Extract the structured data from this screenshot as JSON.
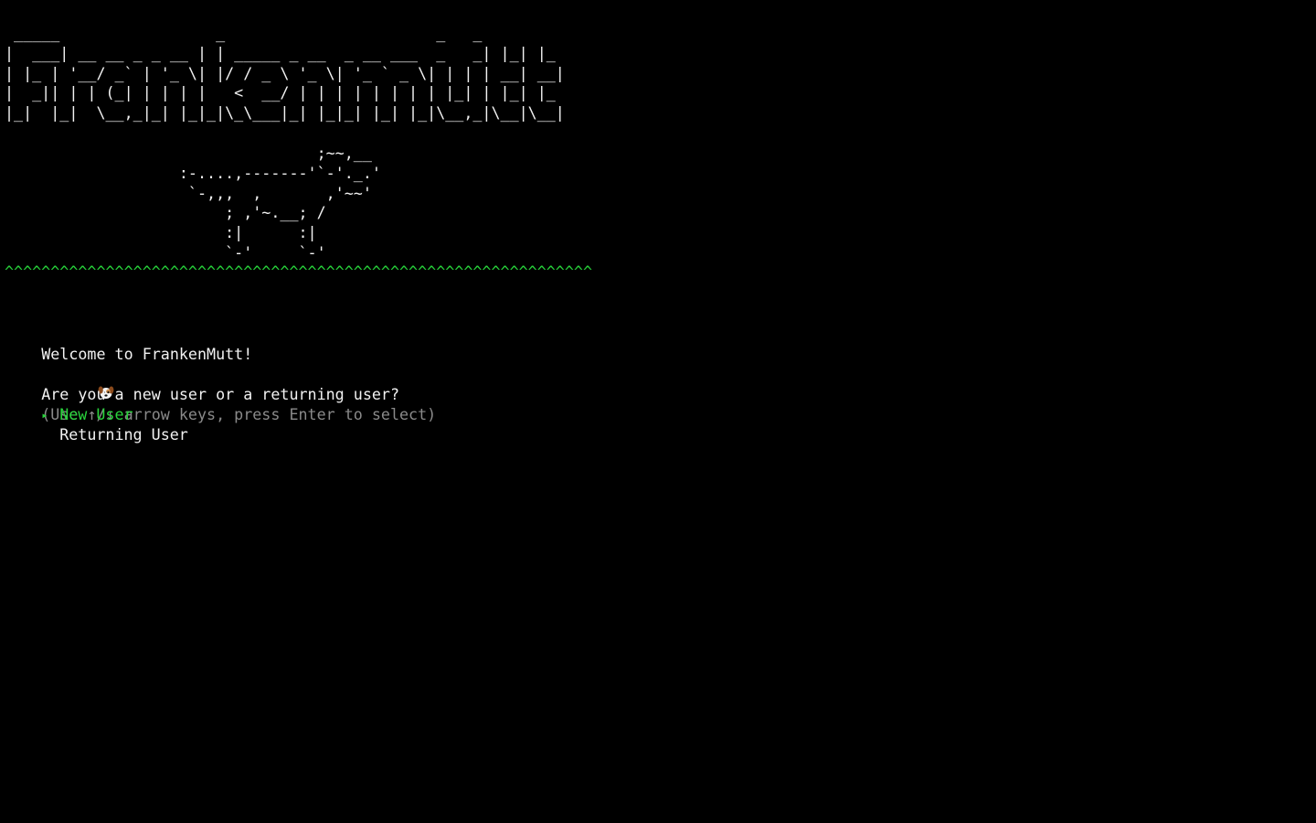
{
  "banner": {
    "ascii_art": " _____                 _                       _   _\n|  ___| __ __ _ _ __ | | _____ _ __  _ __ ___  _   _| |_| |_\n| |_ | '__/ _` | '_ \\| |/ / _ \\ '_ \\| '_ ` _ \\| | | | __| __|\n|  _|| | | (_| | | | |   <  __/ | | | | | | | | |_| | |_| |_\n|_|  |_|  \\__,_|_| |_|_|\\_\\___|_| |_|_| |_| |_|\\__,_|\\__|\\__|"
  },
  "dog_art": "                                  ;~~,__\n                   :-....,-------'`-'._.'\n                    `-,,,  ,       ,'~~'\n                        ; ,'~.__; /\n                        :|      :|\n                        `-'     `-'",
  "grass": "^^^^^^^^^^^^^^^^^^^^^^^^^^^^^^^^^^^^^^^^^^^^^^^^^^^^^^^^^^^^^^^^",
  "welcome": {
    "text": "Welcome to FrankenMutt!",
    "icon": "dog-face-icon"
  },
  "prompt": {
    "question": "Are you a new user or a returning user?",
    "hint": "(Use ↑/↓ arrow keys, press Enter to select)"
  },
  "options": [
    {
      "label": "New User",
      "selected": true
    },
    {
      "label": "Returning User",
      "selected": false
    }
  ],
  "colors": {
    "background": "#000000",
    "foreground": "#f2f2f2",
    "accent_green": "#29d43c",
    "hint_gray": "#8a8a8a"
  }
}
